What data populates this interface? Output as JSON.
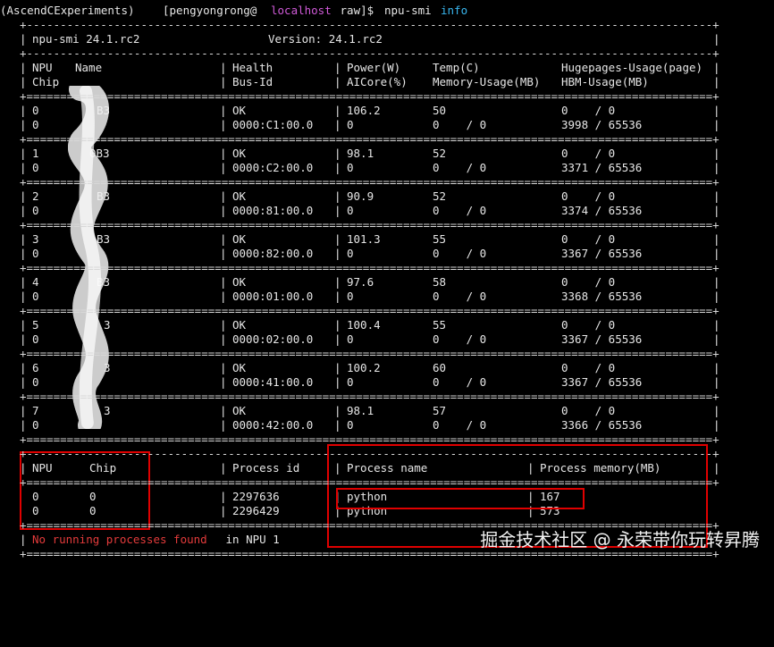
{
  "prompt": {
    "env": "(AscendCExperiments)",
    "user_prefix": "[pengyongrong@",
    "host": "localhost",
    "path_suffix": " raw]$ ",
    "command": "npu-smi",
    "arg": "info"
  },
  "header": {
    "tool": "npu-smi 24.1.rc2",
    "version": "Version: 24.1.rc2"
  },
  "columns": {
    "npu": "NPU",
    "name": "Name",
    "chip": "Chip",
    "health": "Health",
    "bus_id": "Bus-Id",
    "power": "Power(W)",
    "aicore": "AICore(%)",
    "temp": "Temp(C)",
    "mem": "Memory-Usage(MB)",
    "huge": "Hugepages-Usage(page)",
    "hbm": "HBM-Usage(MB)"
  },
  "devices": [
    {
      "npu": "0",
      "name": "B3",
      "chip": "0",
      "health": "OK",
      "bus": "0000:C1:00.0",
      "power": "106.2",
      "aicore": "0",
      "temp": "50",
      "mem": "0    / 0",
      "huge": "0    / 0",
      "hbm": "3998 / 65536"
    },
    {
      "npu": "1",
      "name": "0B3",
      "chip": "0",
      "health": "OK",
      "bus": "0000:C2:00.0",
      "power": "98.1",
      "aicore": "0",
      "temp": "52",
      "mem": "0    / 0",
      "huge": "0    / 0",
      "hbm": "3371 / 65536"
    },
    {
      "npu": "2",
      "name": "B3",
      "chip": "0",
      "health": "OK",
      "bus": "0000:81:00.0",
      "power": "90.9",
      "aicore": "0",
      "temp": "52",
      "mem": "0    / 0",
      "huge": "0    / 0",
      "hbm": "3374 / 65536"
    },
    {
      "npu": "3",
      "name": "B3",
      "chip": "0",
      "health": "OK",
      "bus": "0000:82:00.0",
      "power": "101.3",
      "aicore": "0",
      "temp": "55",
      "mem": "0    / 0",
      "huge": "0    / 0",
      "hbm": "3367 / 65536"
    },
    {
      "npu": "4",
      "name": "B3",
      "chip": "0",
      "health": "OK",
      "bus": "0000:01:00.0",
      "power": "97.6",
      "aicore": "0",
      "temp": "58",
      "mem": "0    / 0",
      "huge": "0    / 0",
      "hbm": "3368 / 65536"
    },
    {
      "npu": "5",
      "name": "3",
      "chip": "0",
      "health": "OK",
      "bus": "0000:02:00.0",
      "power": "100.4",
      "aicore": "0",
      "temp": "55",
      "mem": "0    / 0",
      "huge": "0    / 0",
      "hbm": "3367 / 65536"
    },
    {
      "npu": "6",
      "name": "3",
      "chip": "0",
      "health": "OK",
      "bus": "0000:41:00.0",
      "power": "100.2",
      "aicore": "0",
      "temp": "60",
      "mem": "0    / 0",
      "huge": "0    / 0",
      "hbm": "3367 / 65536"
    },
    {
      "npu": "7",
      "name": "3",
      "chip": "0",
      "health": "OK",
      "bus": "0000:42:00.0",
      "power": "98.1",
      "aicore": "0",
      "temp": "57",
      "mem": "0    / 0",
      "huge": "0    / 0",
      "hbm": "3366 / 65536"
    }
  ],
  "proc_columns": {
    "npu": "NPU",
    "chip": "Chip",
    "pid": "Process id",
    "pname": "Process name",
    "pmem": "Process memory(MB)"
  },
  "processes": [
    {
      "npu": "0",
      "chip": "0",
      "pid": "2297636",
      "name": "python",
      "mem": "167"
    },
    {
      "npu": "0",
      "chip": "0",
      "pid": "2296429",
      "name": "python",
      "mem": "573"
    }
  ],
  "footer": {
    "none_found": "No running processes found",
    "in_npu": " in NPU 1"
  },
  "watermark": "掘金技术社区 @ 永荣带你玩转昇腾",
  "colors": {
    "background": "#000000",
    "text": "#e6e6e6",
    "host": "#d05ad8",
    "arg": "#39b7f0",
    "highlight": "#e00000"
  }
}
